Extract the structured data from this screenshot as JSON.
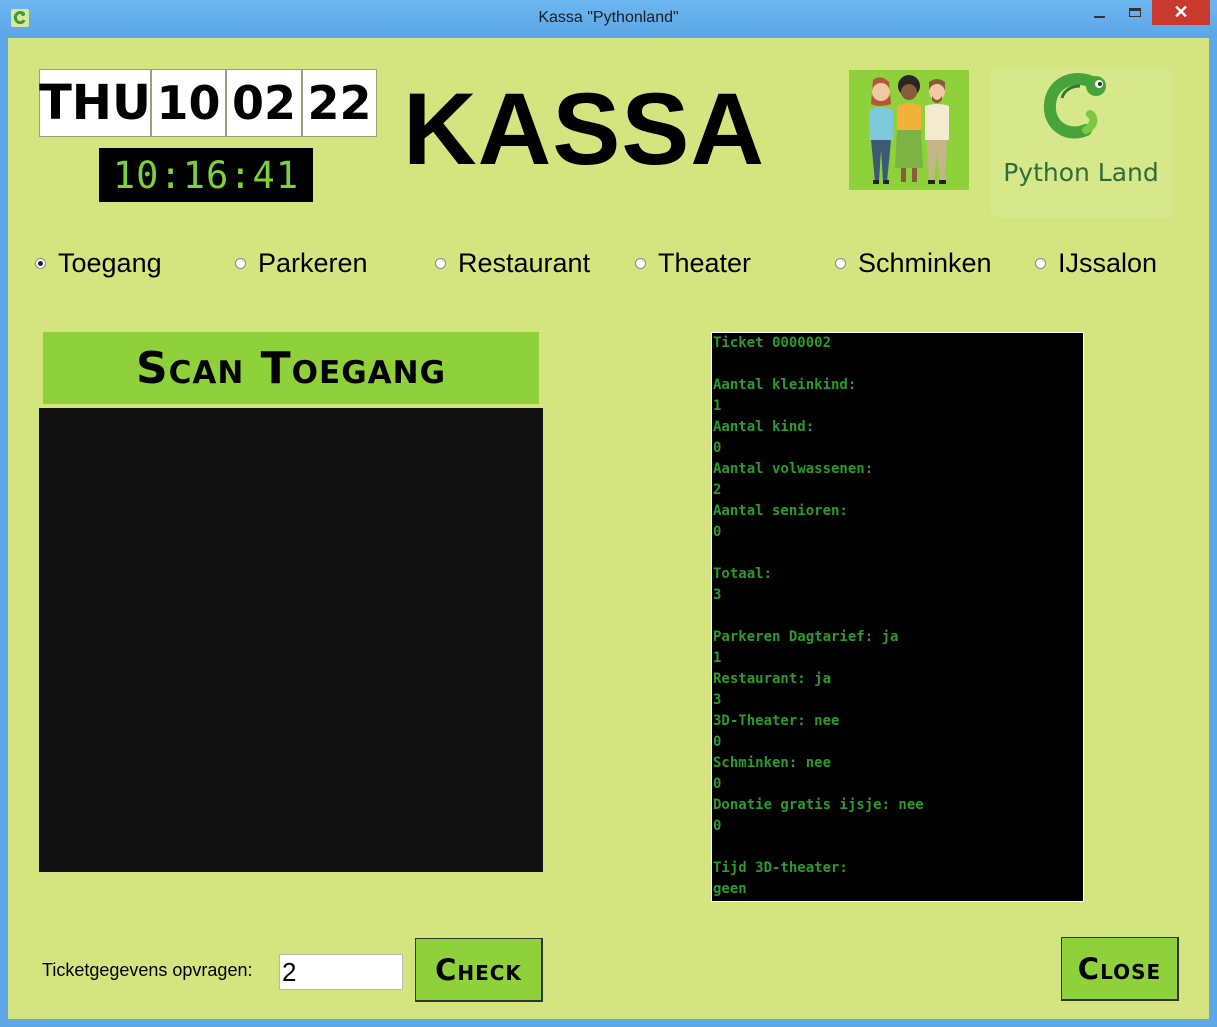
{
  "window": {
    "title": "Kassa \"Pythonland\"",
    "controls": {
      "minimize": "minimize",
      "maximize": "maximize",
      "close": "✕"
    }
  },
  "header": {
    "day": "THU",
    "date_d": "10",
    "date_m": "02",
    "date_y": "22",
    "clock": "10:16:41",
    "title": "KASSA",
    "logo_text": "Python Land"
  },
  "modes": {
    "selected": "Toegang",
    "items": [
      "Toegang",
      "Parkeren",
      "Restaurant",
      "Theater",
      "Schminken",
      "IJssalon"
    ]
  },
  "scan": {
    "title": "Scan Toegang"
  },
  "ticket": {
    "lines": [
      "Ticket 0000002",
      "",
      "Aantal kleinkind:",
      "1",
      "Aantal kind:",
      "0",
      "Aantal volwassenen:",
      "2",
      "Aantal senioren:",
      "0",
      "",
      "Totaal:",
      "3",
      "",
      "Parkeren Dagtarief: ja",
      "1",
      "Restaurant: ja",
      "3",
      "3D-Theater: nee",
      "0",
      "Schminken: nee",
      "0",
      "Donatie gratis ijsje: nee",
      "0",
      "",
      "Tijd 3D-theater:",
      "geen"
    ]
  },
  "footer": {
    "ticket_label": "Ticketgegevens opvragen:",
    "ticket_value": "2",
    "check_label": "Check",
    "close_label": "Close"
  },
  "colors": {
    "background": "#d4e580",
    "accent_green": "#8fd13a",
    "ticket_text": "#2c9a2c",
    "clock_text": "#7dd23a"
  }
}
